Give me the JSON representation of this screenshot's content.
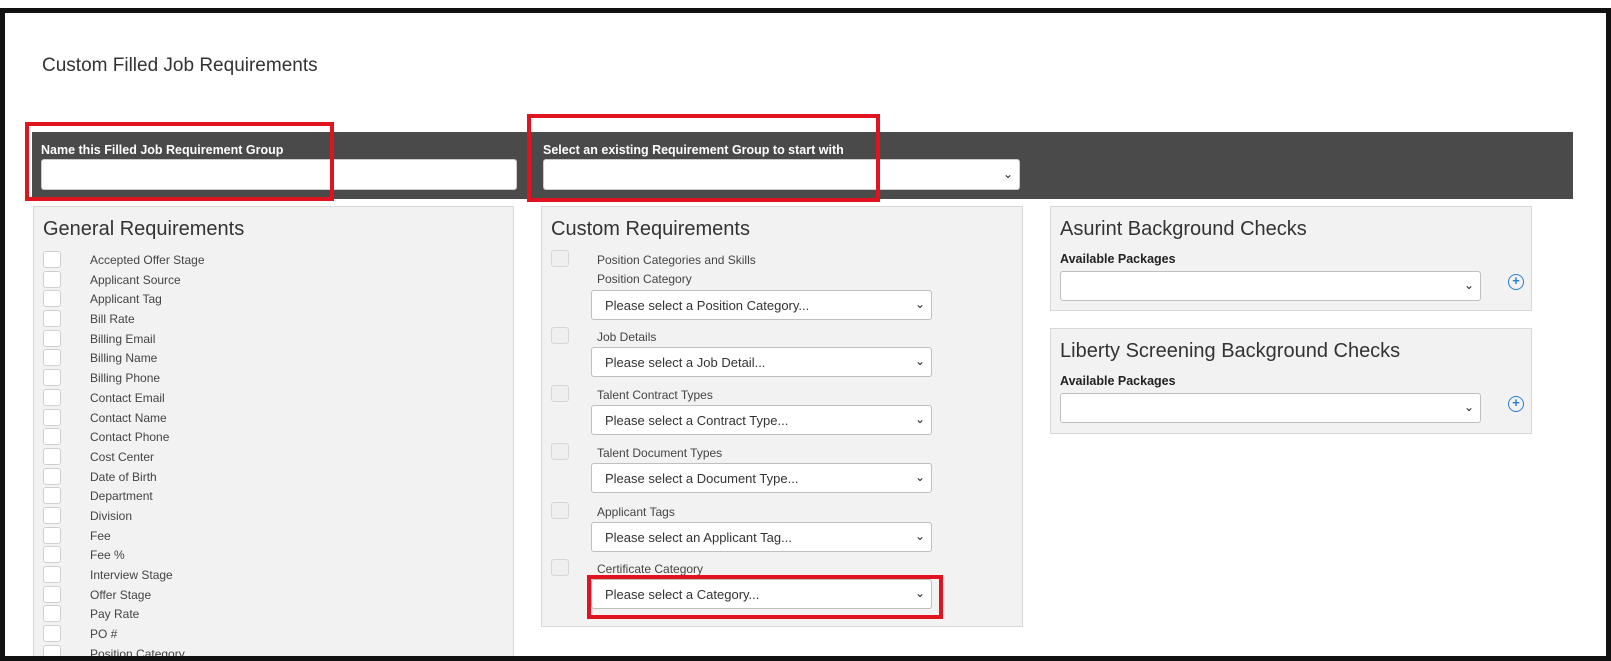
{
  "page": {
    "title": "Custom Filled Job Requirements"
  },
  "bar": {
    "name_label": "Name this Filled Job Requirement Group",
    "name_value": "",
    "existing_label": "Select an existing Requirement Group to start with",
    "existing_value": ""
  },
  "general": {
    "title": "General Requirements",
    "items": [
      "Accepted Offer Stage",
      "Applicant Source",
      "Applicant Tag",
      "Bill Rate",
      "Billing Email",
      "Billing Name",
      "Billing Phone",
      "Contact Email",
      "Contact Name",
      "Contact Phone",
      "Cost Center",
      "Date of Birth",
      "Department",
      "Division",
      "Fee",
      "Fee %",
      "Interview Stage",
      "Offer Stage",
      "Pay Rate",
      "PO #",
      "Position Category"
    ]
  },
  "custom": {
    "title": "Custom Requirements",
    "blocks": [
      {
        "label": "Position Categories and Skills",
        "sublabel": "Position Category",
        "placeholder": "Please select a Position Category..."
      },
      {
        "label": "Job Details",
        "sublabel": "",
        "placeholder": "Please select a Job Detail..."
      },
      {
        "label": "Talent Contract Types",
        "sublabel": "",
        "placeholder": "Please select a Contract Type..."
      },
      {
        "label": "Talent Document Types",
        "sublabel": "",
        "placeholder": "Please select a Document Type..."
      },
      {
        "label": "Applicant Tags",
        "sublabel": "",
        "placeholder": "Please select an Applicant Tag..."
      },
      {
        "label": "Certificate Category",
        "sublabel": "",
        "placeholder": "Please select a Category..."
      }
    ]
  },
  "asurint": {
    "title": "Asurint Background Checks",
    "packages_label": "Available Packages",
    "packages_value": ""
  },
  "liberty": {
    "title": "Liberty Screening Background Checks",
    "packages_label": "Available Packages",
    "packages_value": ""
  },
  "icons": {
    "add": "plus-circle-icon",
    "dropdown": "chevron-down-icon"
  },
  "colors": {
    "bar": "#4a4a4a",
    "highlight": "#e0141e",
    "accent": "#2a7fd1",
    "card": "#f2f2f2"
  }
}
